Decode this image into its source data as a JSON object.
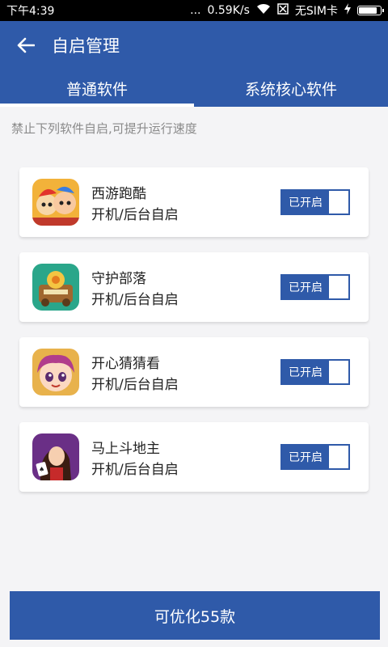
{
  "status_bar": {
    "time": "下午4:39",
    "dots": "...",
    "speed": "0.59K/s",
    "sim": "无SIM卡",
    "battery_level": 0.85
  },
  "app_bar": {
    "title": "自启管理"
  },
  "tabs": [
    {
      "label": "普通软件",
      "active": true
    },
    {
      "label": "系统核心软件",
      "active": false
    }
  ],
  "hint": "禁止下列软件自启,可提升运行速度",
  "apps": [
    {
      "name": "西游跑酷",
      "subtitle": "开机/后台自启",
      "toggle_label": "已开启",
      "enabled": true,
      "icon": "xiyou-paoku-icon"
    },
    {
      "name": "守护部落",
      "subtitle": "开机/后台自启",
      "toggle_label": "已开启",
      "enabled": true,
      "icon": "shouhu-buluo-icon"
    },
    {
      "name": "开心猜猜看",
      "subtitle": "开机/后台自启",
      "toggle_label": "已开启",
      "enabled": true,
      "icon": "kaixin-caicaikan-icon"
    },
    {
      "name": "马上斗地主",
      "subtitle": "开机/后台自启",
      "toggle_label": "已开启",
      "enabled": true,
      "icon": "mashang-doudizhu-icon"
    }
  ],
  "bottom_button": {
    "label": "可优化55款"
  },
  "colors": {
    "primary": "#2f5aa9",
    "background": "#f4f4f6"
  }
}
